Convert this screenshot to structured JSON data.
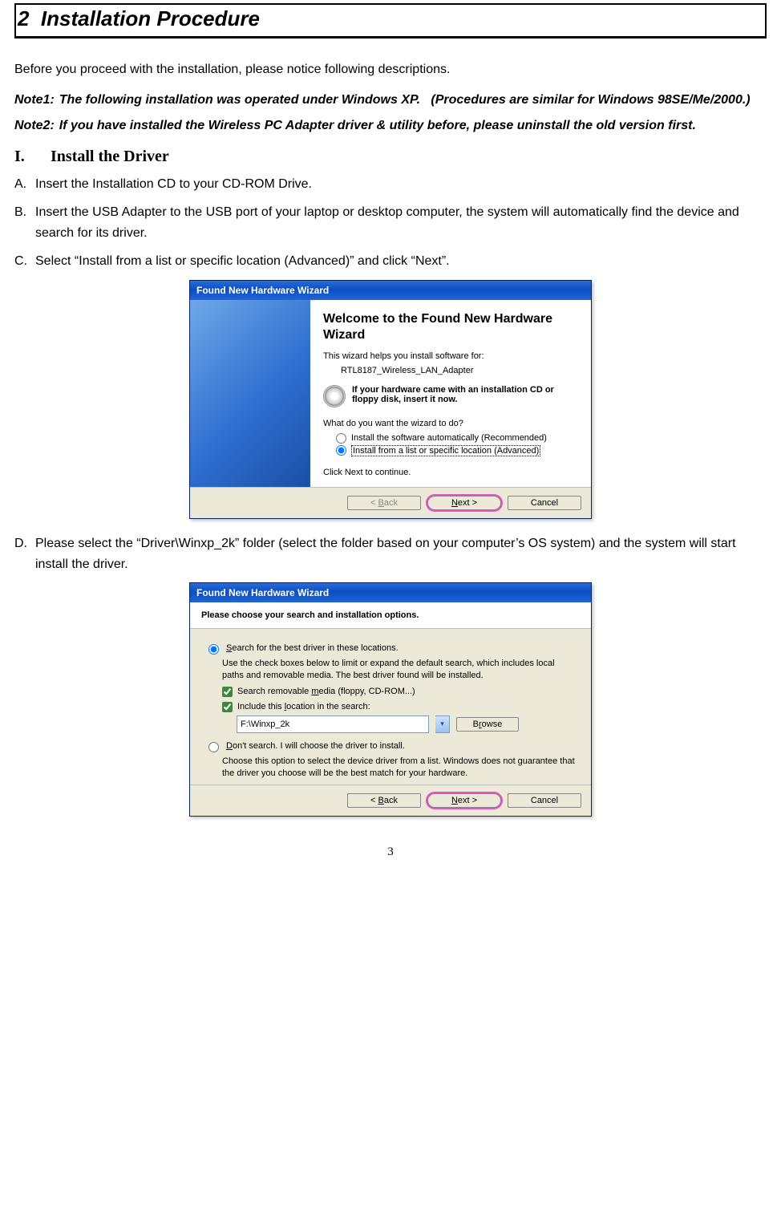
{
  "page": {
    "title_number": "2",
    "title_text": "Installation Procedure",
    "intro": "Before you proceed with the installation, please notice following descriptions.",
    "note1_label": "Note1:",
    "note1_body": "The following installation was operated under Windows XP.   (Procedures are similar for Windows 98SE/Me/2000.)",
    "note2_label": "Note2:",
    "note2_body": "If you have installed the Wireless PC Adapter driver & utility before, please uninstall the old version first.",
    "section_I_num": "I.",
    "section_I_title": "Install the Driver",
    "stepA_lbl": "A.",
    "stepA_txt": "Insert the Installation CD to your CD-ROM Drive.",
    "stepB_lbl": "B.",
    "stepB_txt": "Insert the USB Adapter to the USB port of your laptop or desktop computer, the system will automatically find the device and search for its driver.",
    "stepC_lbl": "C.",
    "stepC_txt": "Select “Install from a list or specific location (Advanced)” and click “Next”.",
    "stepD_lbl": "D.",
    "stepD_txt": "Please select the “Driver\\Winxp_2k” folder (select the folder based on your computer’s OS system) and the system will start install the driver.",
    "page_number": "3"
  },
  "wizard1": {
    "title": "Found New Hardware Wizard",
    "heading": "Welcome to the Found New Hardware Wizard",
    "help_line": "This wizard helps you install software for:",
    "device": "RTL8187_Wireless_LAN_Adapter",
    "cd_hint": "If your hardware came with an installation CD or floppy disk, insert it now.",
    "question": "What do you want the wizard to do?",
    "opt_auto": "Install the software automatically (Recommended)",
    "opt_list": "Install from a list or specific location (Advanced)",
    "click_next": "Click Next to continue.",
    "btn_back": "< Back",
    "btn_next": "Next >",
    "btn_cancel": "Cancel"
  },
  "wizard2": {
    "title": "Found New Hardware Wizard",
    "heading": "Please choose your search and installation options.",
    "opt_search": "Search for the best driver in these locations.",
    "search_sub": "Use the check boxes below to limit or expand the default search, which includes local paths and removable media. The best driver found will be installed.",
    "chk_media": "Search removable media (floppy, CD-ROM...)",
    "chk_include": "Include this location in the search:",
    "path_value": "F:\\Winxp_2k",
    "btn_browse": "Browse",
    "opt_dont": "Don't search. I will choose the driver to install.",
    "dont_sub": "Choose this option to select the device driver from a list.  Windows does not guarantee that the driver you choose will be the best match for your hardware.",
    "btn_back": "< Back",
    "btn_next": "Next >",
    "btn_cancel": "Cancel"
  }
}
